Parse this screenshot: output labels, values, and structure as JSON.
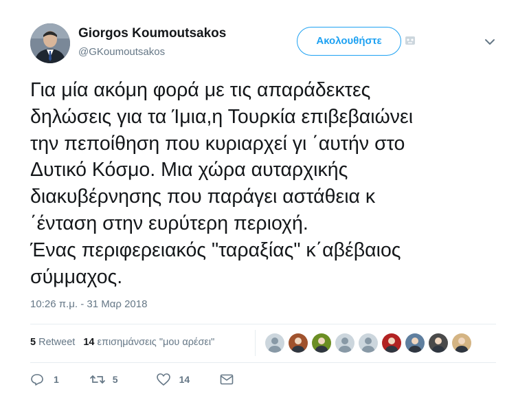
{
  "author": {
    "name": "Giorgos Koumoutsakos",
    "handle": "@GKoumoutsakos",
    "avatar_icon": "profile-photo"
  },
  "header": {
    "follow_label": "Ακολουθήστε",
    "block_icon": "block-icon",
    "menu_icon": "chevron-down-icon"
  },
  "tweet": {
    "text": "Για μία ακόμη φορά με τις απαράδεκτες\nδηλώσεις για τα Ίμια,η Τουρκία επιβεβαιώνει\nτην πεποίθηση που κυριαρχεί γι ΄αυτήν στο\nΔυτικό Κόσμο. Μια χώρα αυταρχικής\nδιακυβέρνησης που παράγει αστάθεια κ\n΄ένταση στην ευρύτερη περιοχή.\nΈνας περιφερειακός \"ταραξίας\" κ΄αβέβαιος\nσύμμαχος.",
    "timestamp": "10:26 π.μ. - 31 Μαρ 2018"
  },
  "stats": {
    "retweet_count": "5",
    "retweet_label": "Retweet",
    "like_count": "14",
    "like_label": "επισημάνσεις \"μου αρέσει\""
  },
  "likers": [
    {
      "icon": "default-avatar",
      "color": "#8899a6"
    },
    {
      "icon": "user-avatar",
      "color": "#a0522d"
    },
    {
      "icon": "user-avatar",
      "color": "#6b8e23"
    },
    {
      "icon": "default-avatar",
      "color": "#8899a6"
    },
    {
      "icon": "default-avatar",
      "color": "#8899a6"
    },
    {
      "icon": "user-avatar",
      "color": "#b22222"
    },
    {
      "icon": "user-avatar",
      "color": "#5f7f9f"
    },
    {
      "icon": "user-avatar",
      "color": "#4a4a4a"
    },
    {
      "icon": "user-avatar",
      "color": "#d4b483"
    }
  ],
  "actions": {
    "reply_count": "1",
    "retweet_count": "5",
    "like_count": "14"
  },
  "colors": {
    "accent": "#1da1f2",
    "muted": "#657786",
    "text": "#14171a",
    "divider": "#e6ecf0"
  }
}
